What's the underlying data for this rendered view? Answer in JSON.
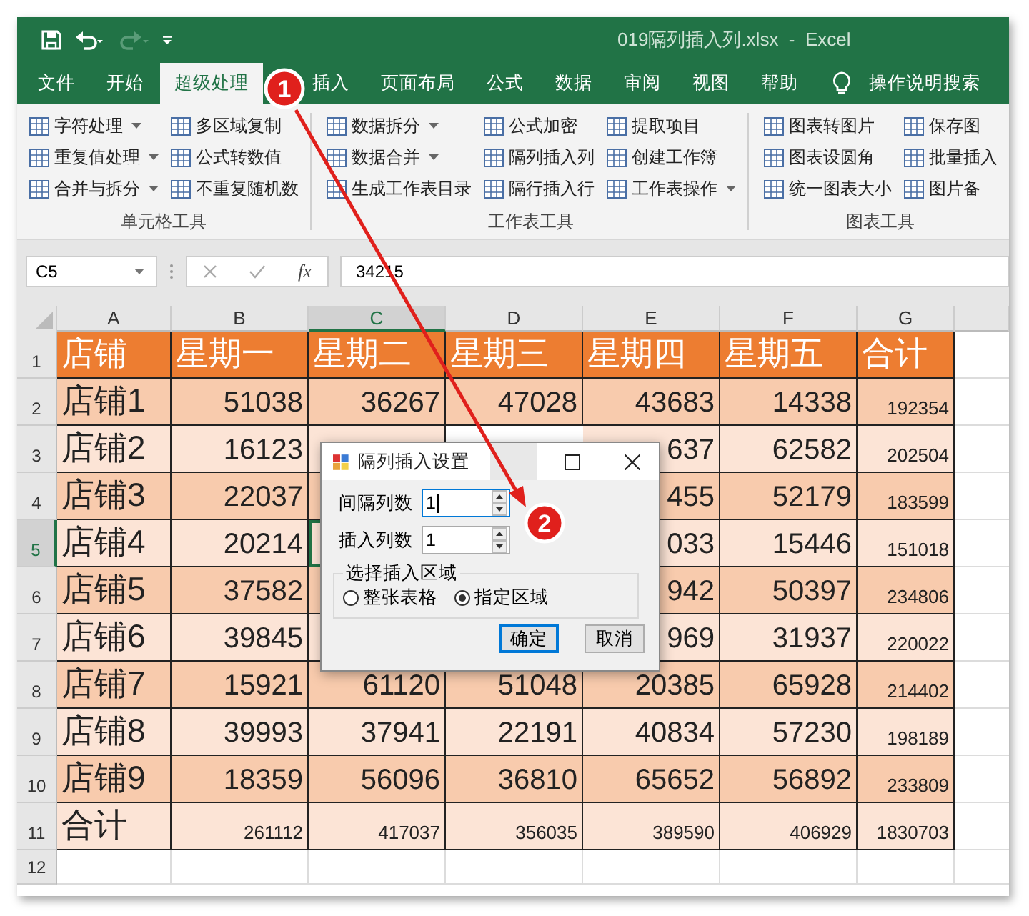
{
  "window": {
    "title": "019隔列插入列.xlsx  -  Excel"
  },
  "tabs": [
    {
      "label": "文件",
      "selected": false
    },
    {
      "label": "开始",
      "selected": false
    },
    {
      "label": "超级处理",
      "selected": true
    },
    {
      "label": "插入",
      "selected": false
    },
    {
      "label": "页面布局",
      "selected": false
    },
    {
      "label": "公式",
      "selected": false
    },
    {
      "label": "数据",
      "selected": false
    },
    {
      "label": "审阅",
      "selected": false
    },
    {
      "label": "视图",
      "selected": false
    },
    {
      "label": "帮助",
      "selected": false
    }
  ],
  "tell_me": "操作说明搜索",
  "ribbon_groups": [
    {
      "label": "单元格工具",
      "columns": [
        [
          {
            "label": "字符处理",
            "dropdown": true
          },
          {
            "label": "重复值处理",
            "dropdown": true
          },
          {
            "label": "合并与拆分",
            "dropdown": true
          }
        ],
        [
          {
            "label": "多区域复制",
            "dropdown": false
          },
          {
            "label": "公式转数值",
            "dropdown": false
          },
          {
            "label": "不重复随机数",
            "dropdown": false
          }
        ]
      ]
    },
    {
      "label": "工作表工具",
      "columns": [
        [
          {
            "label": "数据拆分",
            "dropdown": true
          },
          {
            "label": "数据合并",
            "dropdown": true
          },
          {
            "label": "生成工作表目录",
            "dropdown": false
          }
        ],
        [
          {
            "label": "公式加密",
            "dropdown": false
          },
          {
            "label": "隔列插入列",
            "dropdown": false
          },
          {
            "label": "隔行插入行",
            "dropdown": false
          }
        ],
        [
          {
            "label": "提取项目",
            "dropdown": false
          },
          {
            "label": "创建工作簿",
            "dropdown": false
          },
          {
            "label": "工作表操作",
            "dropdown": true
          }
        ]
      ]
    },
    {
      "label": "图表工具",
      "columns": [
        [
          {
            "label": "图表转图片",
            "dropdown": false
          },
          {
            "label": "图表设圆角",
            "dropdown": false
          },
          {
            "label": "统一图表大小",
            "dropdown": false
          }
        ],
        [
          {
            "label": "保存图",
            "dropdown": false
          },
          {
            "label": "批量插入",
            "dropdown": false
          },
          {
            "label": "图片备",
            "dropdown": false
          }
        ]
      ]
    }
  ],
  "formula_bar": {
    "name_box": "C5",
    "function_label": "fx",
    "formula": "34215"
  },
  "column_headers": [
    {
      "label": "A",
      "selected": false
    },
    {
      "label": "B",
      "selected": false
    },
    {
      "label": "C",
      "selected": true
    },
    {
      "label": "D",
      "selected": false
    },
    {
      "label": "E",
      "selected": false
    },
    {
      "label": "F",
      "selected": false
    },
    {
      "label": "G",
      "selected": false
    }
  ],
  "rows": [
    {
      "number": "1",
      "selected": false,
      "kind": "header",
      "cells": [
        "店铺",
        "星期一",
        "星期二",
        "星期三",
        "星期四",
        "星期五",
        "合计"
      ]
    },
    {
      "number": "2",
      "selected": false,
      "kind": "data",
      "cells": [
        "店铺1",
        "51038",
        "36267",
        "47028",
        "43683",
        "14338",
        "192354"
      ]
    },
    {
      "number": "3",
      "selected": false,
      "kind": "data",
      "cells": [
        "店铺2",
        "16123",
        null,
        null,
        "637",
        "62582",
        "202504"
      ]
    },
    {
      "number": "4",
      "selected": false,
      "kind": "data",
      "cells": [
        "店铺3",
        "22037",
        null,
        null,
        "455",
        "52179",
        "183599"
      ]
    },
    {
      "number": "5",
      "selected": true,
      "kind": "data",
      "cells": [
        "店铺4",
        "20214",
        null,
        null,
        "033",
        "15446",
        "151018"
      ]
    },
    {
      "number": "6",
      "selected": false,
      "kind": "data",
      "cells": [
        "店铺5",
        "37582",
        null,
        null,
        "942",
        "50397",
        "234806"
      ]
    },
    {
      "number": "7",
      "selected": false,
      "kind": "data",
      "cells": [
        "店铺6",
        "39845",
        null,
        null,
        "969",
        "31937",
        "220022"
      ]
    },
    {
      "number": "8",
      "selected": false,
      "kind": "data",
      "cells": [
        "店铺7",
        "15921",
        "61120",
        "51048",
        "20385",
        "65928",
        "214402"
      ]
    },
    {
      "number": "9",
      "selected": false,
      "kind": "data",
      "cells": [
        "店铺8",
        "39993",
        "37941",
        "22191",
        "40834",
        "57230",
        "198189"
      ]
    },
    {
      "number": "10",
      "selected": false,
      "kind": "data",
      "cells": [
        "店铺9",
        "18359",
        "56096",
        "36810",
        "65652",
        "56892",
        "233809"
      ]
    },
    {
      "number": "11",
      "selected": false,
      "kind": "total",
      "cells": [
        "合计",
        "261112",
        "417037",
        "356035",
        "389590",
        "406929",
        "1830703"
      ]
    },
    {
      "number": "12",
      "selected": false,
      "kind": "empty",
      "cells": []
    }
  ],
  "dialog": {
    "title": "隔列插入设置",
    "fields": [
      {
        "label": "间隔列数",
        "value": "1",
        "focused": true
      },
      {
        "label": "插入列数",
        "value": "1",
        "focused": false
      }
    ],
    "group_label": "选择插入区域",
    "radios": [
      {
        "label": "整张表格",
        "selected": false
      },
      {
        "label": "指定区域",
        "selected": true
      }
    ],
    "buttons": [
      {
        "label": "确定",
        "default": true
      },
      {
        "label": "取消",
        "default": false
      }
    ]
  },
  "annotations": [
    {
      "label": "1"
    },
    {
      "label": "2"
    }
  ]
}
